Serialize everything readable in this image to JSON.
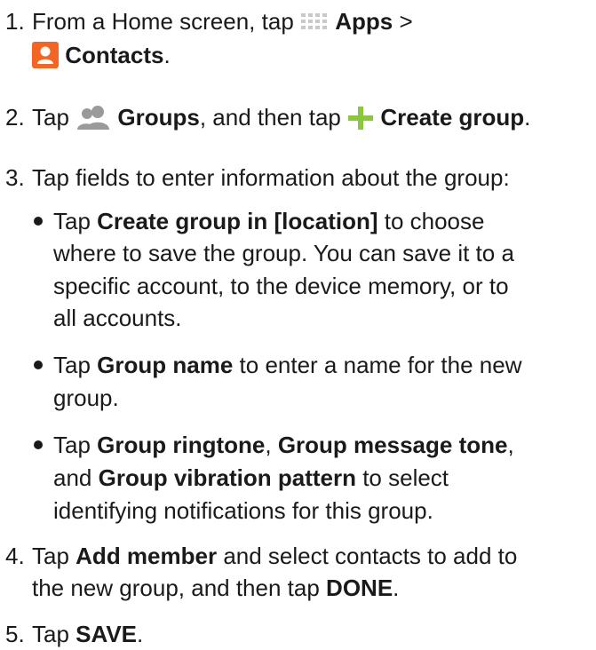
{
  "steps": [
    {
      "number": "1.",
      "pre": "From a Home screen, tap",
      "apps": "Apps",
      "gt": ">",
      "contacts": "Contacts",
      "end": "."
    },
    {
      "number": "2.",
      "pre": "Tap",
      "groups": "Groups",
      "mid": ", and then tap",
      "create": "Create group",
      "end": "."
    },
    {
      "number": "3.",
      "text": "Tap fields to enter information about the group:"
    },
    {
      "number": "4.",
      "pre": "Tap",
      "add": "Add member",
      "mid1": "and select contacts to add to",
      "mid2": "the new group, and then tap",
      "done": "DONE",
      "end": "."
    },
    {
      "number": "5.",
      "pre": "Tap",
      "save": "SAVE",
      "end": "."
    }
  ],
  "bullets": [
    {
      "pre": "Tap",
      "bold": "Create group in [location]",
      "l1": "to choose",
      "l2": "where to save the group. You can save it to a",
      "l3": "specific account, to the device memory, or to",
      "l4": "all accounts."
    },
    {
      "pre": "Tap",
      "bold": "Group name",
      "l1": "to enter a name for the new",
      "l2": "group."
    },
    {
      "pre": "Tap",
      "b1": "Group ringtone",
      "sep": ",",
      "b2": "Group message tone",
      "sep2": ",",
      "and": "and",
      "b3": "Group vibration pattern",
      "l2": "to select",
      "l3": "identifying notifications for this group."
    }
  ],
  "icons": {
    "apps": "apps-grid-icon",
    "contacts": "contacts-icon",
    "groups": "groups-icon",
    "add": "plus-icon",
    "contacts_color": "#f26522",
    "apps_color": "#c8c8c8",
    "groups_color": "#9a9a9a",
    "plus_color": "#8cc63f"
  }
}
